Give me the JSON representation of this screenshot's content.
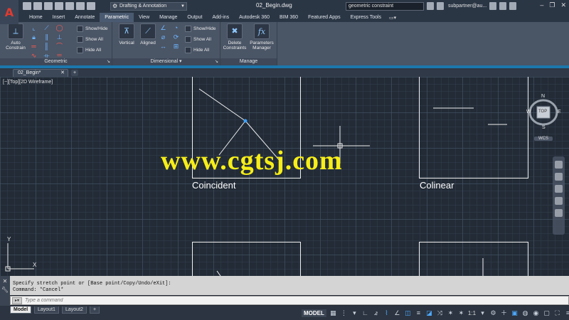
{
  "titlebar": {
    "logo_letter": "A",
    "workspace": "Drafting & Annotation",
    "document_title": "02_Begin.dwg",
    "search_value": "geometric constraint",
    "user": "subpartner@au..."
  },
  "ribbon_tabs": [
    "Home",
    "Insert",
    "Annotate",
    "Parametric",
    "View",
    "Manage",
    "Output",
    "Add-ins",
    "Autodesk 360",
    "BIM 360",
    "Featured Apps",
    "Express Tools"
  ],
  "active_tab": "Parametric",
  "ribbon": {
    "geometric": {
      "title": "Geometric",
      "auto_constrain": "Auto Constrain",
      "show_hide": "Show/Hide",
      "show_all": "Show All",
      "hide_all": "Hide All"
    },
    "dimensional": {
      "title": "Dimensional",
      "vertical": "Vertical",
      "aligned": "Aligned",
      "show_hide": "Show/Hide",
      "show_all": "Show All",
      "hide_all": "Hide All"
    },
    "manage": {
      "title": "Manage",
      "delete_constraints": "Delete Constraints",
      "parameters_manager": "Parameters Manager"
    }
  },
  "file_tab": "02_Begin*",
  "viewport_label": "[−][Top][2D Wireframe]",
  "labels": {
    "coincident": "Coincident",
    "colinear": "Colinear"
  },
  "watermark": "www.cgtsj.com",
  "viewcube": {
    "n": "N",
    "s": "S",
    "e": "E",
    "w": "W",
    "top": "TOP",
    "wcs": "WCS"
  },
  "ucs": {
    "y": "Y",
    "x": "X"
  },
  "command": {
    "history_1": "Specify stretch point or [Base point/Copy/Undo/eXit]:",
    "history_2": "Command: *Cancel*",
    "placeholder": "Type a command"
  },
  "layout_tabs": [
    "Model",
    "Layout1",
    "Layout2"
  ],
  "status": {
    "model": "MODEL",
    "scale": "1:1"
  },
  "colors": {
    "accent": "#1b9adf",
    "watermark": "#f7ee18",
    "canvas": "#222b36"
  }
}
